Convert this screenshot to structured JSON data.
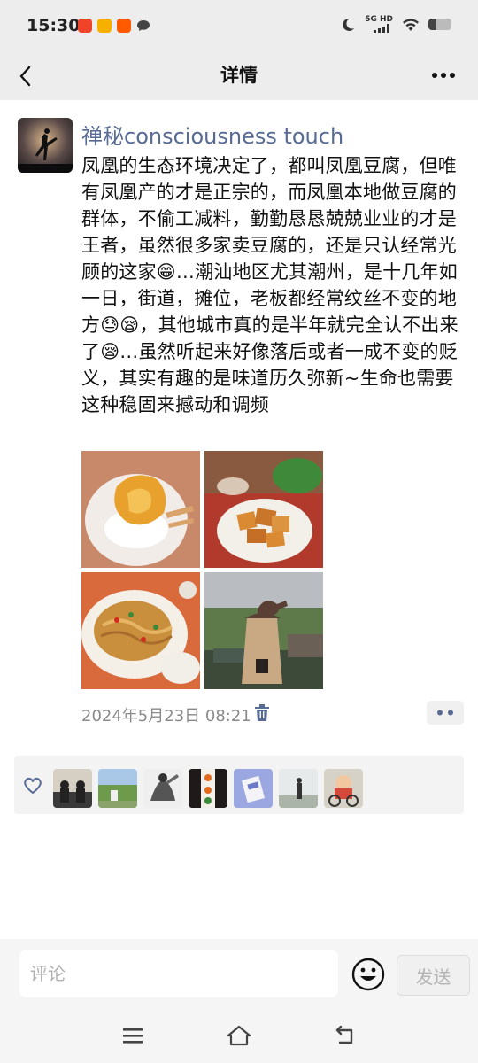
{
  "status_bar": {
    "time": "15:30",
    "network": "5G HD",
    "badge_colors": [
      "#f0432a",
      "#f6b100",
      "#ff5a00"
    ]
  },
  "nav": {
    "title": "详情",
    "back_icon": "chevron-left-icon",
    "more_icon": "more-dots-icon"
  },
  "post": {
    "author": "禅秘consciousness touch",
    "text": "凤凰的生态环境决定了，都叫凤凰豆腐，但唯有凤凰产的才是正宗的，而凤凰本地做豆腐的群体，不偷工减料，勤勤恳恳兢兢业业的才是王者，虽然很多家卖豆腐的，还是只认经常光顾的这家😁…潮汕地区尤其潮州，是十几年如一日，街道，摊位，老板都经常纹丝不变的地方😓😪，其他城市真的是半年就完全认不出来了😪…虽然听起来好像落后或者一成不变的贬义，其实有趣的是味道历久弥新~生命也需要这种稳固来撼动和调频",
    "photos": [
      "tofu-in-bowl",
      "fried-tofu-plate",
      "fried-noodles-plate",
      "clay-stove-garden"
    ],
    "timestamp": "2024年5月23日 08:21"
  },
  "likes": {
    "count": 7,
    "heart_color": "#576b95"
  },
  "composer": {
    "placeholder": "评论",
    "send_label": "发送"
  },
  "system_nav": [
    "menu-icon",
    "home-icon",
    "back-icon"
  ],
  "colors": {
    "link": "#576b95",
    "bar_bg": "#ededed"
  }
}
